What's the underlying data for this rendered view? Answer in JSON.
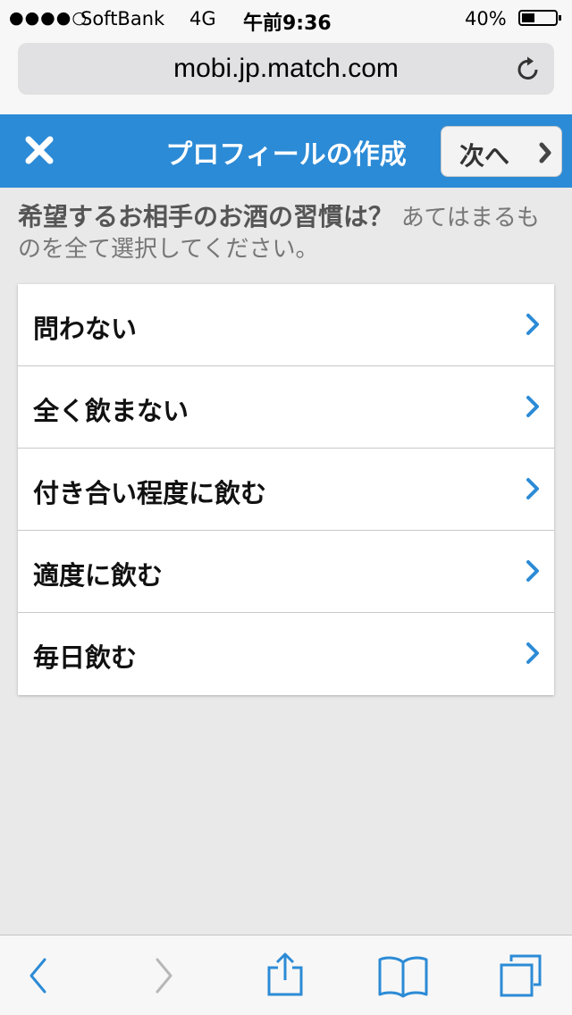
{
  "status_bar": {
    "signal": "●●●●○",
    "carrier": "SoftBank",
    "network": "4G",
    "time": "午前9:36",
    "battery_percent": "40%",
    "battery_level": 0.4
  },
  "browser": {
    "url": "mobi.jp.match.com",
    "reload_icon": "reload-icon"
  },
  "header": {
    "close_icon": "close-icon",
    "title": "プロフィールの作成",
    "next_label": "次へ",
    "accent_color": "#2c8bd6"
  },
  "question": {
    "main": "希望するお相手のお酒の習慣は？",
    "sub": "あてはまるものを全て選択してください。"
  },
  "options": [
    {
      "label": "問わない"
    },
    {
      "label": "全く飲まない"
    },
    {
      "label": "付き合い程度に飲む"
    },
    {
      "label": "適度に飲む"
    },
    {
      "label": "毎日飲む"
    }
  ],
  "toolbar": {
    "icons": [
      "back-icon",
      "forward-icon",
      "share-icon",
      "bookmarks-icon",
      "tabs-icon"
    ]
  }
}
